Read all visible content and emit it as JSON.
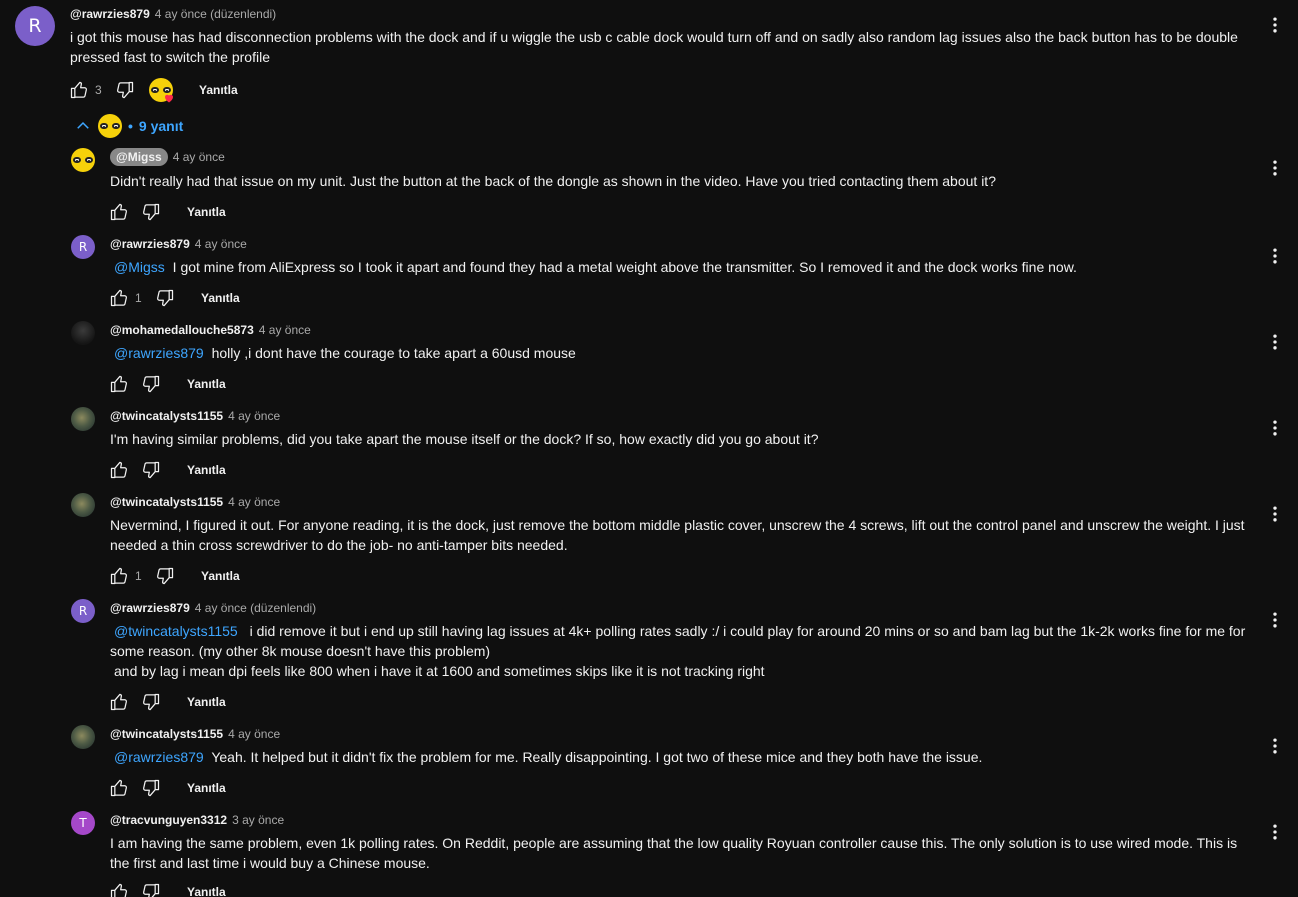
{
  "top_comment": {
    "avatar_letter": "R",
    "avatar_color": "#7b5fc9",
    "username": "@rawrzies879",
    "time": "4 ay önce (düzenlendi)",
    "text": "i got this mouse has had disconnection problems with the dock and if u wiggle the usb c cable dock would turn off and on sadly also random lag issues also the back button has to be double pressed fast to switch the profile",
    "like_count": "3",
    "reply_label": "Yanıtla"
  },
  "replies_toggle": {
    "label": "9 yanıt"
  },
  "replies": [
    {
      "username": "@Migss",
      "time": "4 ay önce",
      "mention": "",
      "text": "Didn't really had that issue on my unit. Just the button at the back of the dongle as shown in the video. Have you tried contacting them about it?",
      "like_count": "",
      "reply_label": "Yanıtla"
    },
    {
      "avatar_letter": "R",
      "username": "@rawrzies879",
      "time": "4 ay önce",
      "mention": "@Migss",
      "text": "I got mine from AliExpress so I took it apart and found they had a metal weight above the transmitter. So I removed it and the dock works fine now.",
      "like_count": "1",
      "reply_label": "Yanıtla"
    },
    {
      "username": "@mohamedallouche5873",
      "time": "4 ay önce",
      "mention": "@rawrzies879",
      "text": "holly ,i dont have the courage to take apart a 60usd mouse",
      "like_count": "",
      "reply_label": "Yanıtla"
    },
    {
      "username": "@twincatalysts1155",
      "time": "4 ay önce",
      "mention": "",
      "text": "I'm having similar problems, did you take apart the mouse itself or the dock? If so, how exactly did you go about it?",
      "like_count": "",
      "reply_label": "Yanıtla"
    },
    {
      "username": "@twincatalysts1155",
      "time": "4 ay önce",
      "mention": "",
      "text": "Nevermind, I figured it out. For anyone reading, it is the dock, just remove the bottom middle plastic cover, unscrew the 4 screws, lift out the control panel and unscrew the weight. I just needed a thin cross screwdriver to do the job- no anti-tamper bits needed.",
      "like_count": "1",
      "reply_label": "Yanıtla"
    },
    {
      "avatar_letter": "R",
      "username": "@rawrzies879",
      "time": "4 ay önce (düzenlendi)",
      "mention": "@twincatalysts1155",
      "text": "i did remove it but i end up still having lag issues at 4k+ polling rates sadly :/ i could play for around 20 mins or so and bam lag but the 1k-2k works fine for me for some reason. (my other 8k mouse doesn't have this problem)",
      "text2": "and by lag i mean dpi feels like 800 when i have it at 1600 and sometimes skips like it is not tracking right",
      "like_count": "",
      "reply_label": "Yanıtla"
    },
    {
      "username": "@twincatalysts1155",
      "time": "4 ay önce",
      "mention": "@rawrzies879",
      "text": "Yeah. It helped but it didn't fix the problem for me. Really disappointing. I got two of these mice and they both have the issue.",
      "like_count": "",
      "reply_label": "Yanıtla"
    },
    {
      "avatar_letter": "T",
      "username": "@tracvunguyen3312",
      "time": "3 ay önce",
      "mention": "",
      "text": "I am having the same problem, even 1k polling rates. On Reddit, people are assuming that the low quality Royuan controller cause this. The only solution is to use wired mode. This is the first and last time i would buy a Chinese mouse.",
      "like_count": "",
      "reply_label": "Yanıtla"
    }
  ],
  "colors": {
    "background": "#0f0f0f",
    "text": "#f1f1f1",
    "secondary": "#aaaaaa",
    "link": "#3ea6ff",
    "avatar_r": "#7b5fc9",
    "avatar_t": "#a548c9"
  },
  "icons": [
    "thumb-up-icon",
    "thumb-down-icon",
    "more-vert-icon",
    "chevron-up-icon",
    "heart-icon"
  ]
}
